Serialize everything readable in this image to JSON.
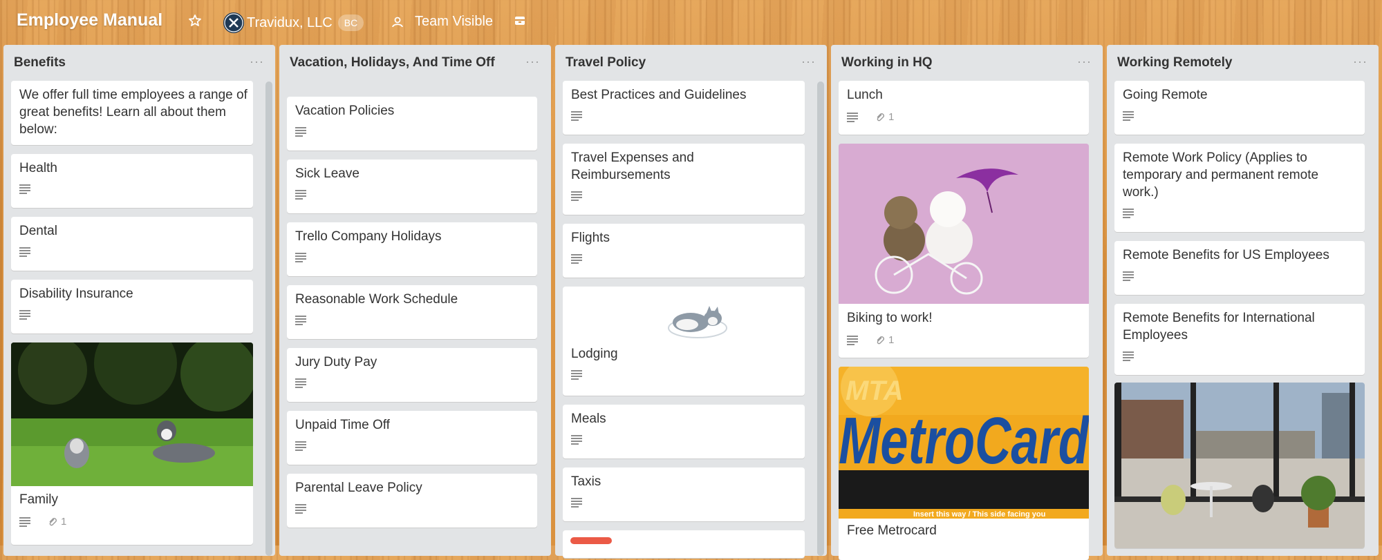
{
  "header": {
    "board_title": "Employee Manual",
    "org_name": "Travidux, LLC",
    "org_badge": "BC",
    "visibility": "Team Visible",
    "icons": [
      "star-icon",
      "org-logo-icon",
      "team-visibility-icon",
      "butler-icon"
    ]
  },
  "lists": [
    {
      "title": "Benefits",
      "cards": [
        {
          "title": "We offer full time employees a range of great benefits! Learn all about them below:"
        },
        {
          "title": "Health",
          "desc": true
        },
        {
          "title": "Dental",
          "desc": true
        },
        {
          "title": "Disability Insurance",
          "desc": true
        },
        {
          "title": "Family",
          "desc": true,
          "attachments": "1",
          "cover": "huskies-on-grass"
        }
      ]
    },
    {
      "title": "Vacation, Holidays, And Time Off",
      "cards": [
        {
          "title": "Vacation Policies",
          "desc": true
        },
        {
          "title": "Sick Leave",
          "desc": true
        },
        {
          "title": "Trello Company Holidays",
          "desc": true
        },
        {
          "title": "Reasonable Work Schedule",
          "desc": true
        },
        {
          "title": "Jury Duty Pay",
          "desc": true
        },
        {
          "title": "Unpaid Time Off",
          "desc": true
        },
        {
          "title": "Parental Leave Policy",
          "desc": true
        }
      ]
    },
    {
      "title": "Travel Policy",
      "cards": [
        {
          "title": "Best Practices and Guidelines",
          "desc": true
        },
        {
          "title": "Travel Expenses and Reimbursements",
          "desc": true
        },
        {
          "title": "Flights",
          "desc": true
        },
        {
          "title": "Lodging",
          "desc": true,
          "cover": "sleeping-husky-sticker"
        },
        {
          "title": "Meals",
          "desc": true
        },
        {
          "title": "Taxis",
          "desc": true
        },
        {
          "title": "",
          "label_color": "#eb5a46"
        }
      ]
    },
    {
      "title": "Working in HQ",
      "cards": [
        {
          "title": "Lunch",
          "desc": true,
          "attachments": "1"
        },
        {
          "title": "Biking to work!",
          "desc": true,
          "attachments": "1",
          "cover": "kittens-on-bicycle"
        },
        {
          "title": "Free Metrocard",
          "cover": "metrocard"
        }
      ]
    },
    {
      "title": "Working Remotely",
      "cards": [
        {
          "title": "Going Remote",
          "desc": true
        },
        {
          "title": "Remote Work Policy (Applies to temporary and permanent remote work.)",
          "desc": true
        },
        {
          "title": "Remote Benefits for US Employees",
          "desc": true
        },
        {
          "title": "Remote Benefits for International Employees",
          "desc": true
        },
        {
          "title": "",
          "cover": "office-window-view"
        }
      ]
    }
  ],
  "metrocard": {
    "brand": "MetroCard",
    "mta": "MTA",
    "strip": "Insert this way / This side facing you"
  },
  "colors": {
    "list_bg": "#e2e4e6",
    "label_red": "#eb5a46",
    "text": "#333333",
    "wood": "#d8913f"
  }
}
